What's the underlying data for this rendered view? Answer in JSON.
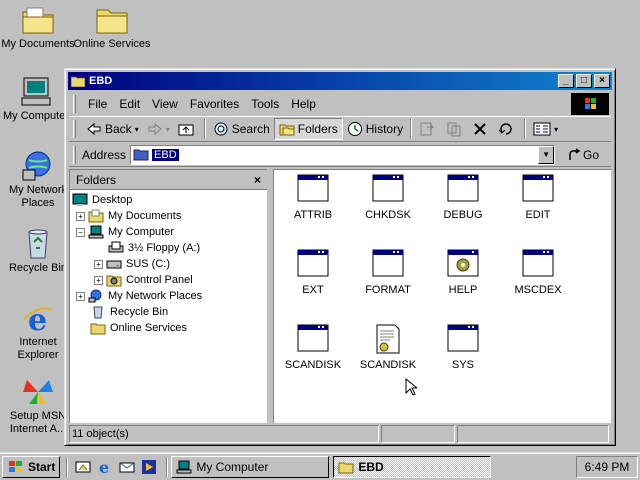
{
  "desktop": {
    "icons": [
      {
        "label": "My Documents",
        "icon": "my-documents-icon"
      },
      {
        "label": "Online Services",
        "icon": "folder-icon"
      },
      {
        "label": "My Computer",
        "icon": "computer-icon"
      },
      {
        "label": "My Network Places",
        "icon": "network-icon"
      },
      {
        "label": "Recycle Bin",
        "icon": "recycle-bin-icon"
      },
      {
        "label": "Internet Explorer",
        "icon": "ie-icon"
      },
      {
        "label": "Setup MSN Internet A...",
        "icon": "msn-icon"
      }
    ]
  },
  "window": {
    "title": "EBD",
    "menu": [
      "File",
      "Edit",
      "View",
      "Favorites",
      "Tools",
      "Help"
    ],
    "toolbar": {
      "back": "Back",
      "search": "Search",
      "folders": "Folders",
      "history": "History"
    },
    "address": {
      "label": "Address",
      "value": "EBD",
      "go": "Go"
    },
    "folders_pane": {
      "title": "Folders",
      "close": "×",
      "tree": [
        {
          "label": "Desktop",
          "expander": ""
        },
        {
          "label": "My Documents",
          "expander": "+"
        },
        {
          "label": "My Computer",
          "expander": "−"
        },
        {
          "label": "3½ Floppy (A:)",
          "expander": ""
        },
        {
          "label": "SUS (C:)",
          "expander": "+"
        },
        {
          "label": "Control Panel",
          "expander": "+"
        },
        {
          "label": "My Network Places",
          "expander": "+"
        },
        {
          "label": "Recycle Bin",
          "expander": ""
        },
        {
          "label": "Online Services",
          "expander": ""
        }
      ]
    },
    "files": [
      {
        "label": "ATTRIB",
        "icon": "program-icon"
      },
      {
        "label": "CHKDSK",
        "icon": "program-icon"
      },
      {
        "label": "DEBUG",
        "icon": "program-icon"
      },
      {
        "label": "EDIT",
        "icon": "program-icon"
      },
      {
        "label": "EXT",
        "icon": "program-icon"
      },
      {
        "label": "FORMAT",
        "icon": "program-icon"
      },
      {
        "label": "HELP",
        "icon": "batch-file-icon"
      },
      {
        "label": "MSCDEX",
        "icon": "program-icon"
      },
      {
        "label": "SCANDISK",
        "icon": "program-icon"
      },
      {
        "label": "SCANDISK",
        "icon": "settings-file-icon"
      },
      {
        "label": "SYS",
        "icon": "program-icon"
      }
    ],
    "status": "11 object(s)"
  },
  "taskbar": {
    "start": "Start",
    "tasks": [
      {
        "label": "My Computer",
        "active": false
      },
      {
        "label": "EBD",
        "active": true
      }
    ],
    "clock": "6:49 PM"
  },
  "colors": {
    "desktop": "#c0c0c0",
    "titlebar_start": "#000080",
    "titlebar_end": "#1084d0",
    "selection": "#000080"
  }
}
